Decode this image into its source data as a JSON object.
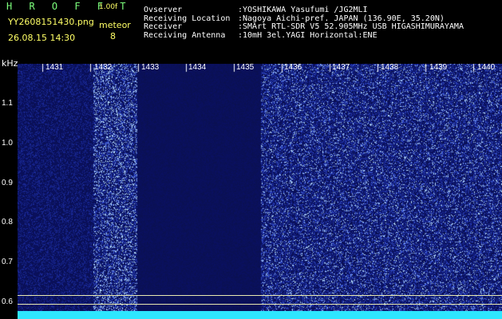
{
  "header": {
    "brand": "H R O F F T",
    "version": "1.00f",
    "filename": "YY2608151430.png",
    "meteor_label": "meteor",
    "timestamp": "26.08.15 14:30",
    "meteor_count": "8"
  },
  "info": [
    {
      "label": "Ovserver",
      "value": ":YOSHIKAWA Yasufumi /JG2MLI"
    },
    {
      "label": "Receiving Location",
      "value": ":Nagoya Aichi-pref. JAPAN (136.90E, 35.20N)"
    },
    {
      "label": "Receiver",
      "value": ":SMArt RTL-SDR V5 52.905MHz USB HIGASHIMURAYAMA"
    },
    {
      "label": "Receiving Antenna",
      "value": ":10mH 3el.YAGI Horizontal:ENE"
    }
  ],
  "y_axis": {
    "unit": "kHz",
    "ticks": [
      "1.1",
      "1.0",
      "0.9",
      "0.8",
      "0.7",
      "0.6"
    ]
  },
  "minute_labels": [
    "1431",
    "1432",
    "1433",
    "1434",
    "1435",
    "1436",
    "1437",
    "1438",
    "1439",
    "1440"
  ],
  "colors": {
    "background": "#000000",
    "waterfall_base": "#10185a",
    "noise_floor": "#2ee6ff",
    "title_text": "#ffff66",
    "brand_text": "#7dff7d"
  }
}
